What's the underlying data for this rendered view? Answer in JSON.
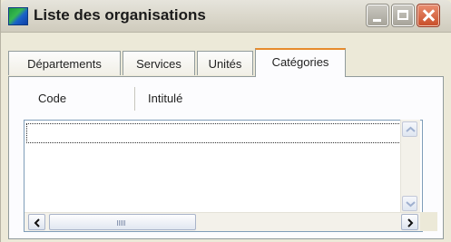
{
  "window": {
    "title": "Liste des organisations",
    "icon": "app-icon",
    "controls": {
      "minimize": "minimize-icon",
      "maximize": "maximize-icon",
      "close": "close-icon"
    }
  },
  "tabs": [
    {
      "label": "Départements",
      "active": false
    },
    {
      "label": "Services",
      "active": false
    },
    {
      "label": "Unités",
      "active": false
    },
    {
      "label": "Catégories",
      "active": true
    }
  ],
  "list": {
    "columns": [
      {
        "label": "Code"
      },
      {
        "label": "Intitulé"
      }
    ],
    "rows": []
  },
  "colors": {
    "active_tab_accent": "#e68b2c",
    "close_button": "#c9502b",
    "list_border": "#7f9db9"
  }
}
